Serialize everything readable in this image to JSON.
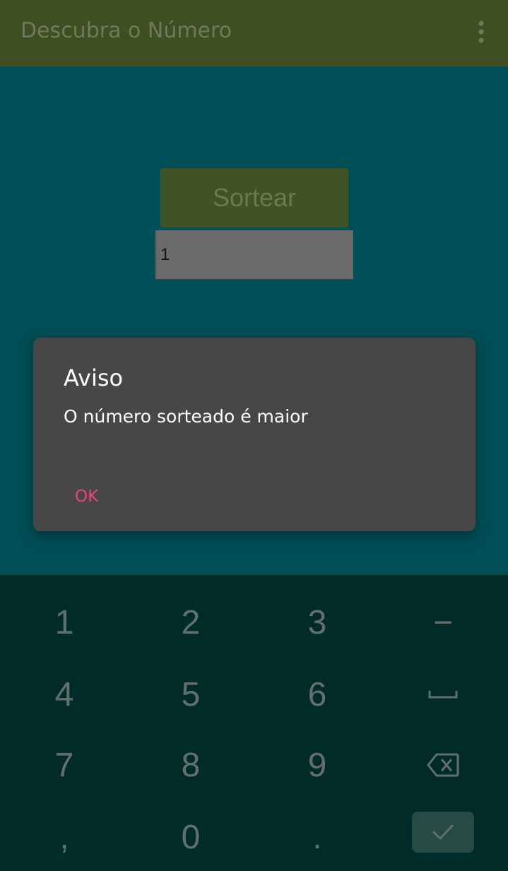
{
  "appbar": {
    "title": "Descubra o Número",
    "menu_icon": "more-vert-icon"
  },
  "main": {
    "draw_button_label": "Sortear",
    "number_input_value": "1"
  },
  "dialog": {
    "title": "Aviso",
    "message": "O número sorteado é maior",
    "ok_label": "OK"
  },
  "keyboard": {
    "row1": [
      "1",
      "2",
      "3",
      "−"
    ],
    "row2": [
      "4",
      "5",
      "6"
    ],
    "row3": [
      "7",
      "8",
      "9"
    ],
    "row4": [
      ",",
      "0",
      "."
    ],
    "icons": {
      "space": "space-bar-icon",
      "backspace": "backspace-icon",
      "done": "check-icon"
    }
  },
  "colors": {
    "appbar": "#3f4f22",
    "background": "#004e56",
    "dialog": "#474747",
    "accent": "#e8447c",
    "keyboard": "#002b28"
  }
}
